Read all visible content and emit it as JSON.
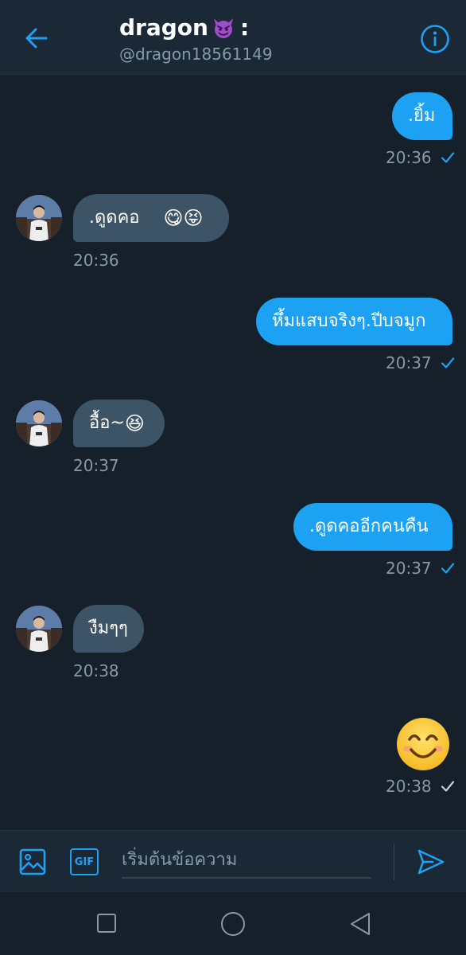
{
  "header": {
    "name": "dragon",
    "name_suffix": ":",
    "handle": "@dragon18561149"
  },
  "icons": {
    "back": "arrow-left-icon",
    "info": "info-icon",
    "image": "image-icon",
    "gif": "gif-icon",
    "send": "send-icon",
    "devil_emoji": "smiling-imp-emoji",
    "nav_recent": "square-icon",
    "nav_home": "circle-icon",
    "nav_back": "triangle-back-icon"
  },
  "colors": {
    "background": "#15202b",
    "header": "#1b2836",
    "accent": "#1da1f2",
    "received_bubble": "#3d5466",
    "secondary_text": "#8899a6"
  },
  "messages": [
    {
      "direction": "sent",
      "text": ".ยิ้ม",
      "time": "20:36",
      "status": "read"
    },
    {
      "direction": "received",
      "text": ".ดูดคอ",
      "emoji": "😋😝",
      "time": "20:36"
    },
    {
      "direction": "sent",
      "text": "หึ้มแสบจริงๆ.ปีบจมูก",
      "time": "20:37",
      "status": "read"
    },
    {
      "direction": "received",
      "text": "อื้อ~",
      "emoji": "😆",
      "time": "20:37"
    },
    {
      "direction": "sent",
      "text": ".ดูดคออีกคนคืน",
      "time": "20:37",
      "status": "read"
    },
    {
      "direction": "received",
      "text": "งืมๆๆ",
      "time": "20:38"
    },
    {
      "direction": "sent",
      "emoji": "😊",
      "time": "20:38",
      "status": "sent"
    }
  ],
  "composer": {
    "placeholder": "เริ่มต้นข้อความ",
    "gif_label": "GIF"
  }
}
